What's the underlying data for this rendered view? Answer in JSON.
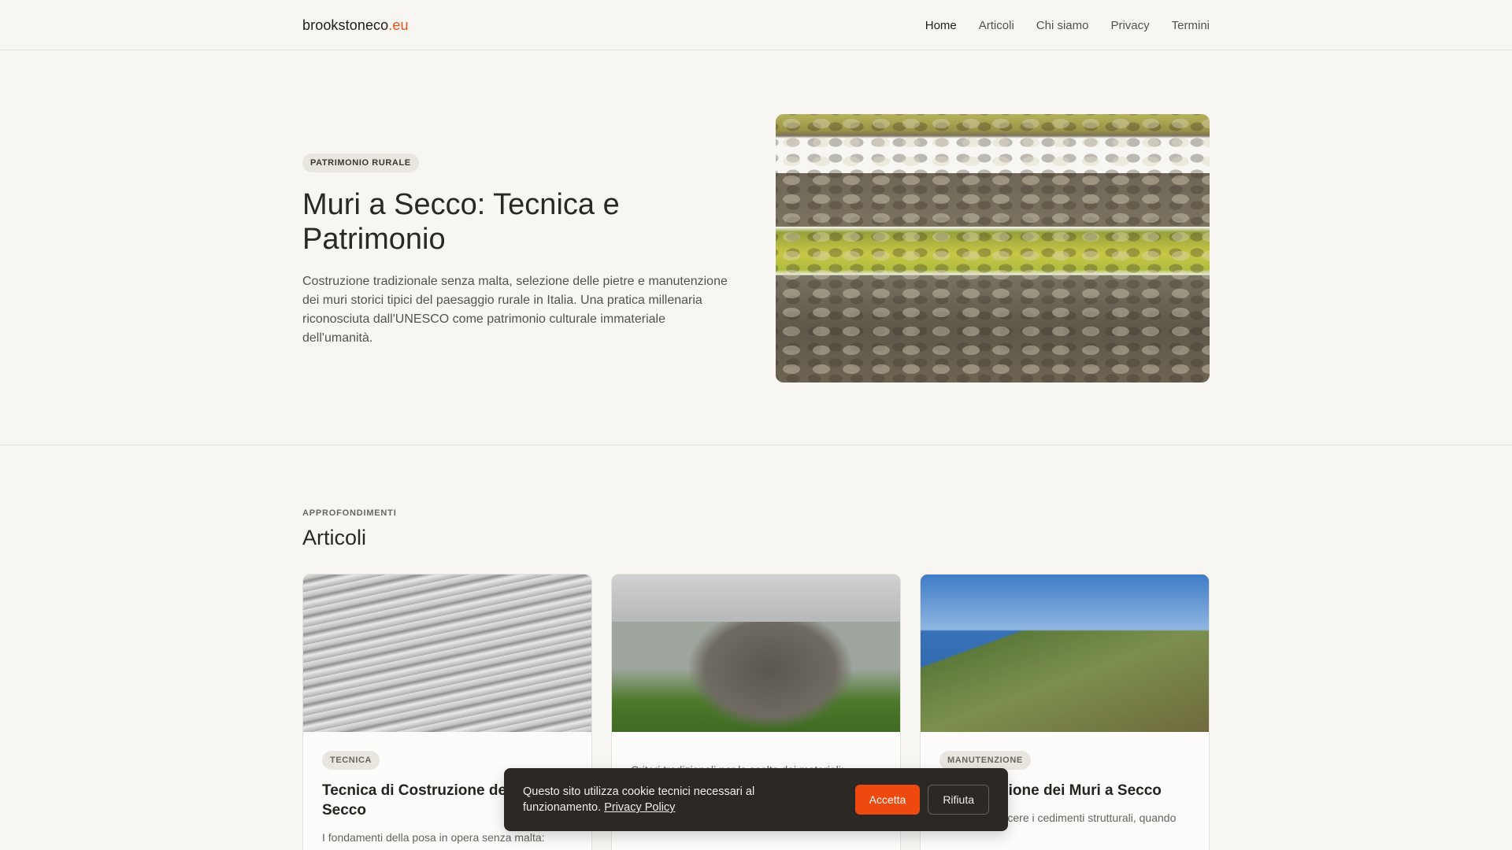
{
  "header": {
    "logo_main": "brookstoneco",
    "logo_tld": ".eu",
    "nav": [
      "Home",
      "Articoli",
      "Chi siamo",
      "Privacy",
      "Termini"
    ],
    "active_nav": "Home"
  },
  "hero": {
    "badge": "PATRIMONIO RURALE",
    "title": "Muri a Secco: Tecnica e Patrimonio",
    "description": "Costruzione tradizionale senza malta, selezione delle pietre e manutenzione dei muri storici tipici del paesaggio rurale in Italia. Una pratica millenaria riconosciuta dall'UNESCO come patrimonio culturale immateriale dell'umanità."
  },
  "articles": {
    "eyebrow": "APPROFONDIMENTI",
    "title": "Articoli",
    "cards": [
      {
        "tag": "TECNICA",
        "title": "Tecnica di Costruzione dei Muri a Secco",
        "excerpt": "I fondamenti della posa in opera senza malta:"
      },
      {
        "tag": "",
        "title": "",
        "excerpt": "Criteri tradizionali per la scelta dei materiali:"
      },
      {
        "tag": "MANUTENZIONE",
        "title": "Manutenzione dei Muri a Secco",
        "excerpt": "Come riconoscere i cedimenti strutturali, quando"
      }
    ]
  },
  "cookie": {
    "text": "Questo sito utilizza cookie tecnici necessari al funzionamento.",
    "link": "Privacy Policy",
    "accept": "Accetta",
    "reject": "Rifiuta"
  },
  "colors": {
    "accent": "#ee4a10",
    "background": "#f7f6f2",
    "banner": "#2b2825"
  }
}
